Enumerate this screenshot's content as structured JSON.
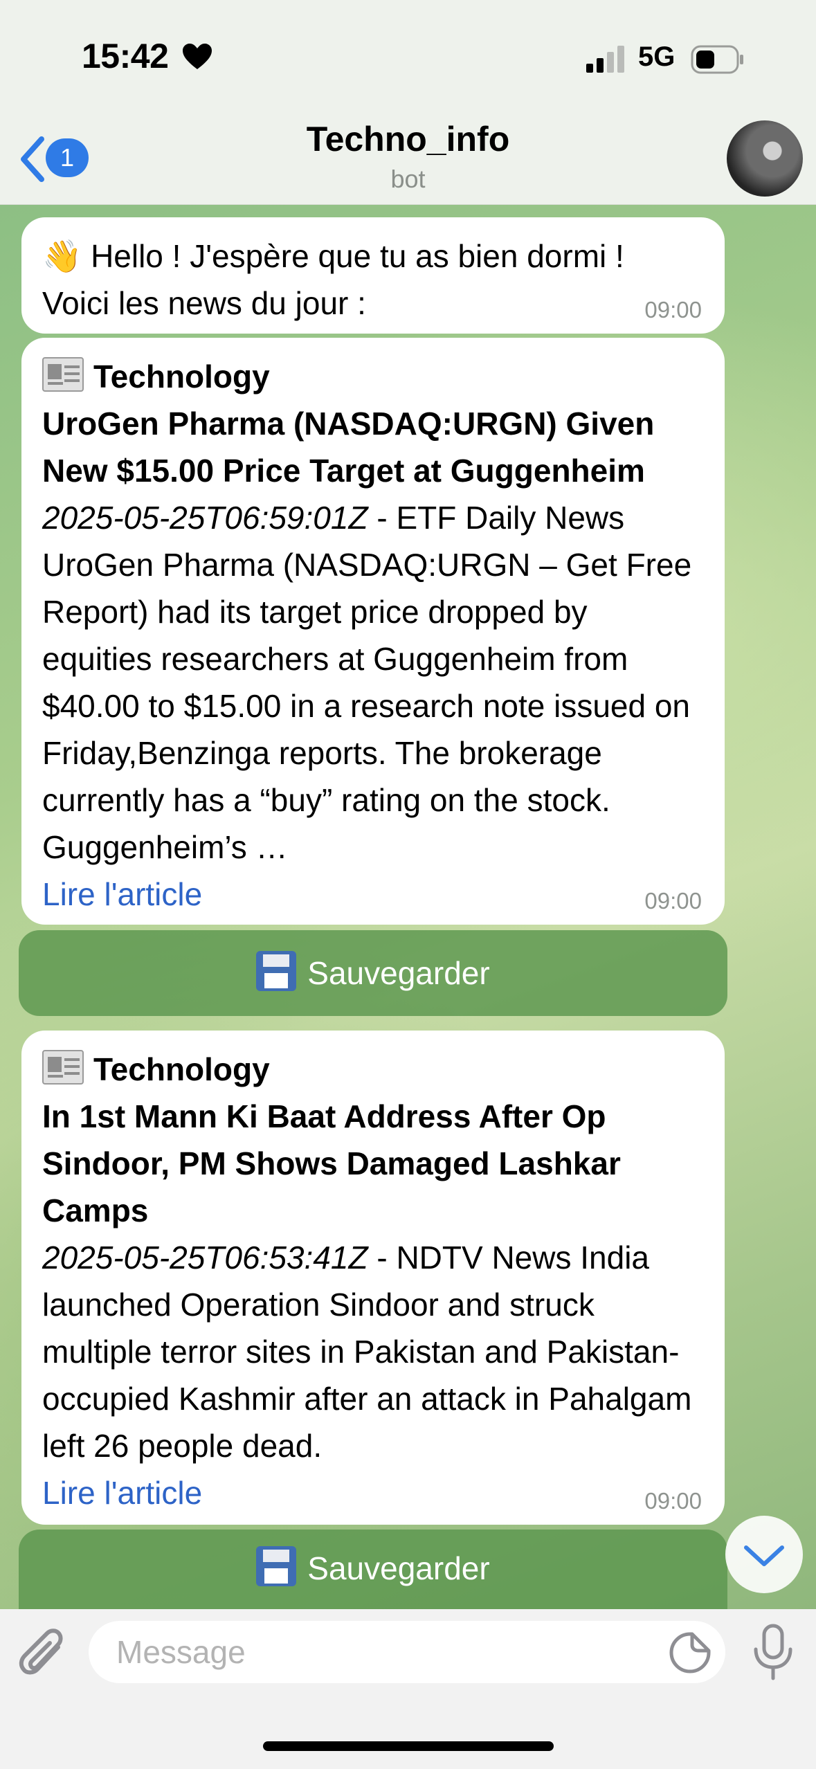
{
  "status": {
    "time": "15:42",
    "network": "5G"
  },
  "header": {
    "back_count": "1",
    "title": "Techno_info",
    "subtitle": "bot"
  },
  "messages": [
    {
      "lines": [
        "Hello ! J'espère que tu as bien dormi !",
        "Voici les news du jour :"
      ],
      "time": "09:00"
    },
    {
      "category": "Technology",
      "headline": "UroGen Pharma (NASDAQ:URGN) Given New $15.00 Price Target at Guggenheim",
      "date": "2025-05-25T06:59:01Z",
      "source": " - ETF Daily News",
      "body": "UroGen Pharma (NASDAQ:URGN – Get Free Report) had its target price dropped by equities researchers at Guggenheim from $40.00 to $15.00 in a research note issued on Friday,Benzinga reports. The brokerage currently has a “buy” rating on the stock. Guggenheim’s …",
      "link": "Lire l'article",
      "time": "09:00",
      "button": "Sauvegarder"
    },
    {
      "category": "Technology",
      "headline": "In 1st Mann Ki Baat Address After Op Sindoor, PM Shows Damaged Lashkar Camps",
      "date": "2025-05-25T06:53:41Z",
      "source": " - NDTV News",
      "body": "India launched Operation Sindoor and struck multiple terror sites in Pakistan and Pakistan-occupied Kashmir after an attack in Pahalgam left 26 people dead.",
      "link": "Lire l'article",
      "time": "09:00",
      "button": "Sauvegarder"
    }
  ],
  "composer": {
    "placeholder": "Message"
  },
  "icons": {
    "heart": "heart-icon",
    "signal": "cellular-signal-icon",
    "battery": "battery-icon",
    "back": "chevron-left-icon",
    "wave": "waving-hand-icon",
    "news": "newspaper-icon",
    "save": "floppy-disk-icon",
    "scroll": "chevron-down-icon",
    "attach": "paperclip-icon",
    "sticker": "sticker-icon",
    "mic": "microphone-icon"
  },
  "colors": {
    "accent": "#2f7be6",
    "link": "#2d63c7",
    "save_button": "#5c964e"
  }
}
